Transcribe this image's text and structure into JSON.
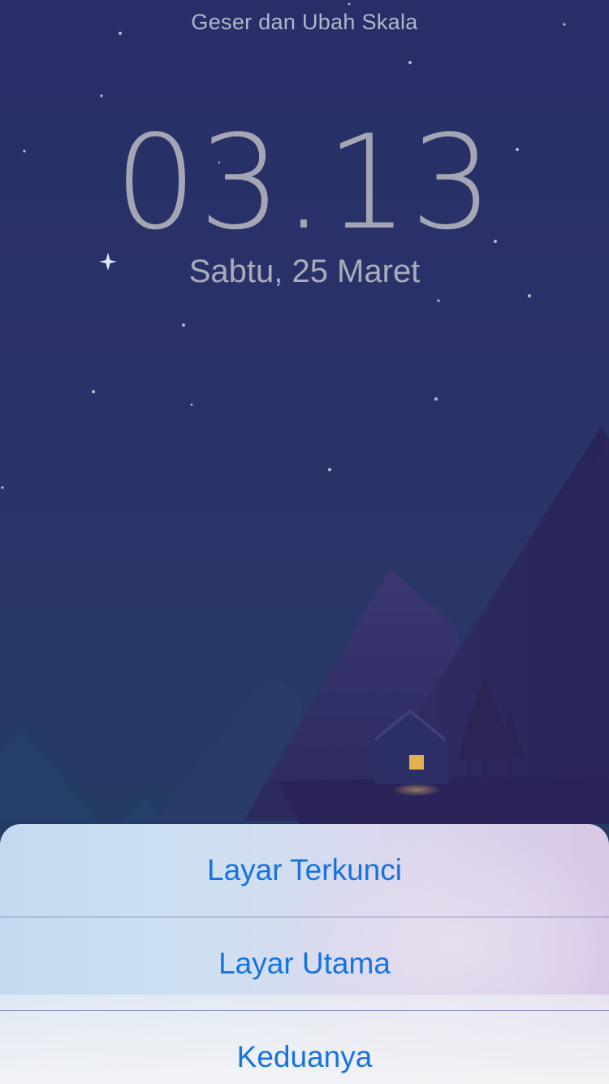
{
  "lockscreen": {
    "hint": "Geser dan Ubah Skala",
    "time": "03.13",
    "date": "Sabtu, 25 Maret"
  },
  "action_sheet": {
    "options": [
      {
        "label": "Layar Terkunci"
      },
      {
        "label": "Layar Utama"
      },
      {
        "label": "Keduanya"
      }
    ]
  },
  "colors": {
    "sky_top": "#27306a",
    "sky_bottom": "#28406a",
    "mountain": "#332f6a",
    "action_text": "#1673de",
    "window_light": "#e3b24c"
  }
}
